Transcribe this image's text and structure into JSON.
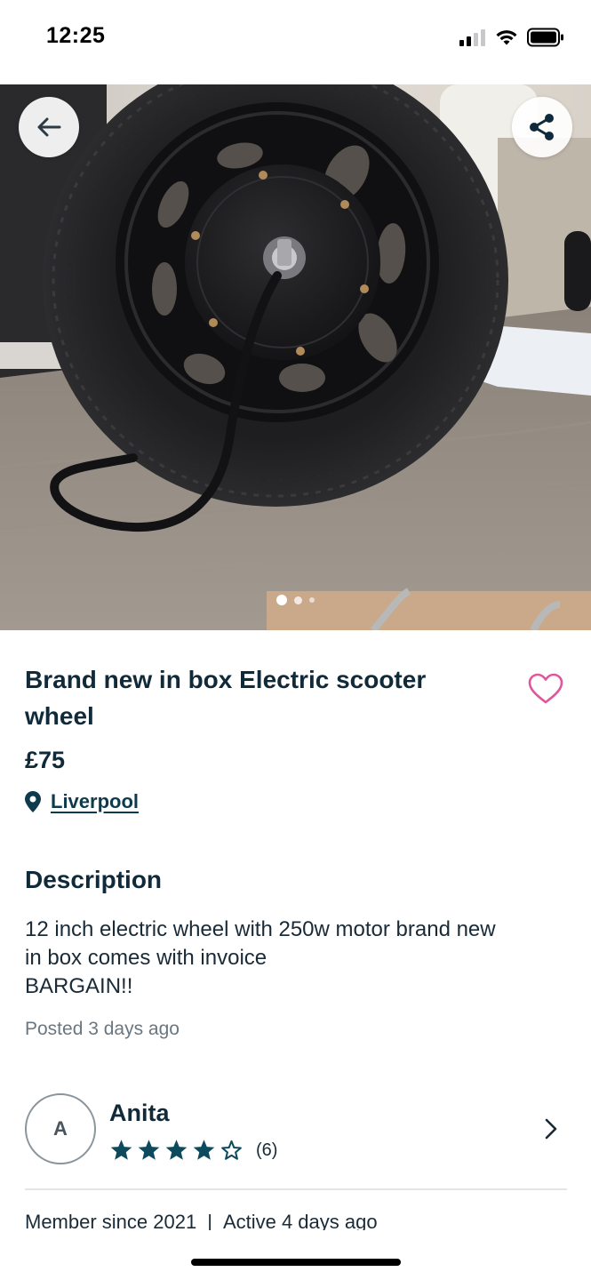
{
  "status_bar": {
    "time": "12:25"
  },
  "gallery": {
    "image_subject": "electric-scooter-wheel-photo",
    "page_count": 3,
    "current_page": 1
  },
  "listing": {
    "title": "Brand new in box Electric scooter wheel",
    "price": "£75",
    "location": "Liverpool",
    "favorited": false
  },
  "description": {
    "heading": "Description",
    "lines": [
      "12 inch electric wheel with 250w motor brand new",
      "in box comes with invoice",
      "BARGAIN!!"
    ],
    "posted": "Posted 3 days ago"
  },
  "seller": {
    "initial": "A",
    "name": "Anita",
    "rating": 4,
    "rating_max": 5,
    "review_count": "(6)",
    "member_since": "Member since 2021",
    "separator": "|",
    "active": "Active 4 days ago"
  },
  "colors": {
    "primary_text": "#102a39",
    "accent_teal": "#0e4a5e",
    "heart_pink": "#e0569a",
    "secondary_text": "#6b7780"
  },
  "icons": {
    "back": "arrow-left-icon",
    "share": "share-icon",
    "favorite": "heart-icon",
    "location": "map-pin-icon",
    "star": "star-icon",
    "chevron": "chevron-right-icon"
  }
}
